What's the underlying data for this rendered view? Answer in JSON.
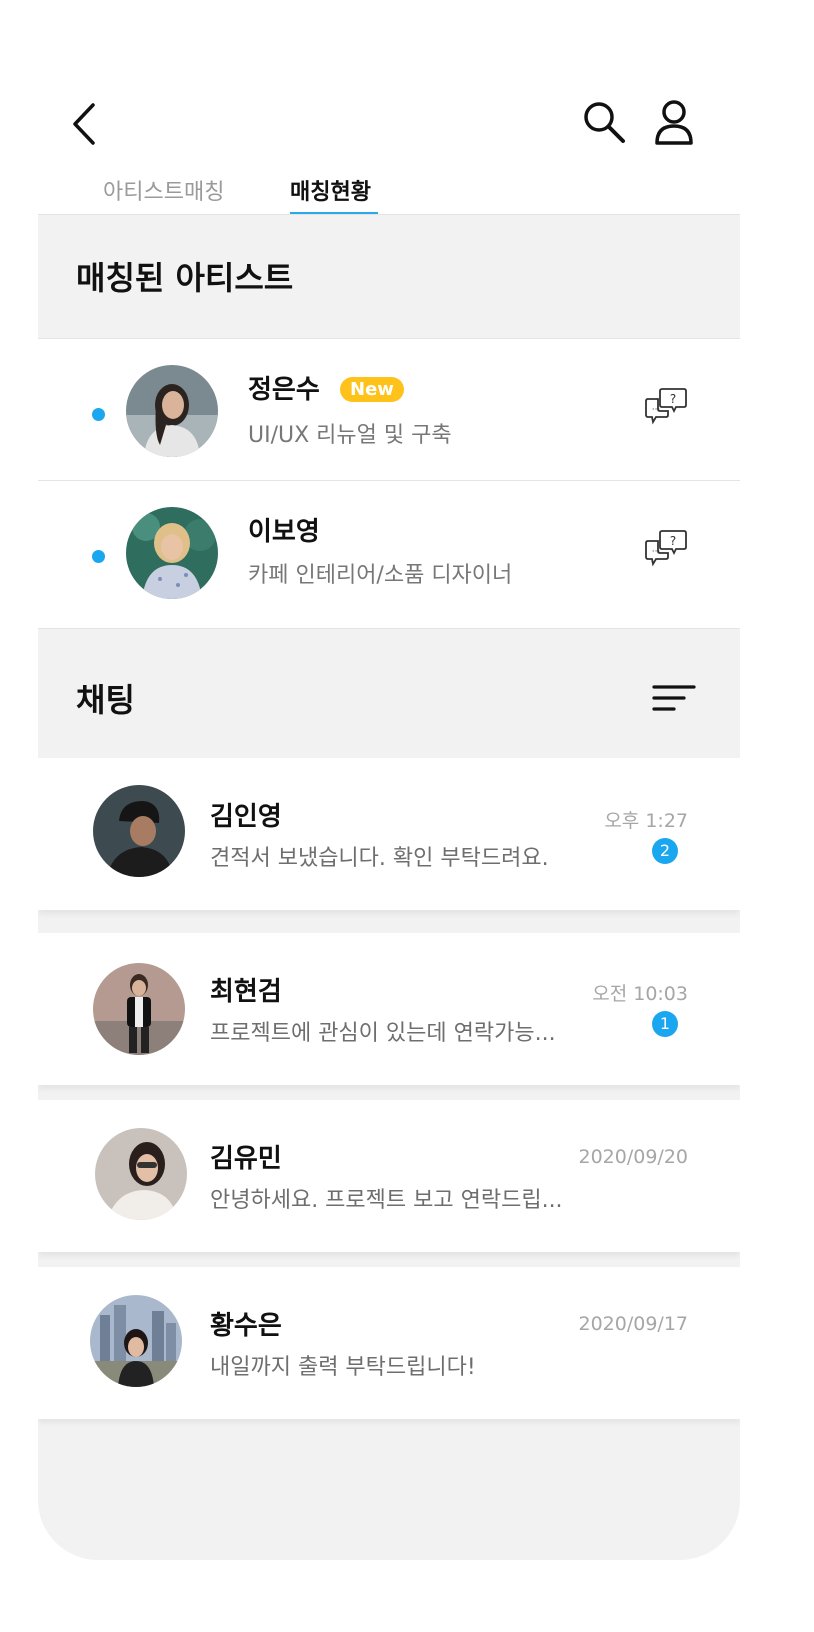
{
  "tabs": {
    "artist_matching": "아티스트매칭",
    "matching_status": "매칭현황"
  },
  "matched": {
    "title": "매칭된 아티스트",
    "items": [
      {
        "name": "정은수",
        "badge": "New",
        "subtitle": "UI/UX 리뉴얼 및 구축"
      },
      {
        "name": "이보영",
        "subtitle": "카페 인테리어/소품 디자이너"
      }
    ]
  },
  "chats": {
    "title": "채팅",
    "items": [
      {
        "name": "김인영",
        "time": "오후 1:27",
        "message": "견적서 보냈습니다. 확인 부탁드려요.",
        "unread": "2"
      },
      {
        "name": "최현검",
        "time": "오전 10:03",
        "message": "프로젝트에 관심이 있는데 연락가능...",
        "unread": "1"
      },
      {
        "name": "김유민",
        "time": "2020/09/20",
        "message": "안녕하세요. 프로젝트 보고 연락드립..."
      },
      {
        "name": "황수은",
        "time": "2020/09/17",
        "message": "내일까지 출력 부탁드립니다!"
      }
    ]
  },
  "colors": {
    "accent": "#1aa7f0",
    "badge": "#ffc21a",
    "section_bg": "#f2f2f2"
  },
  "icons": [
    "back-arrow-icon",
    "search-icon",
    "profile-icon",
    "chat-question-icon",
    "sort-icon"
  ]
}
